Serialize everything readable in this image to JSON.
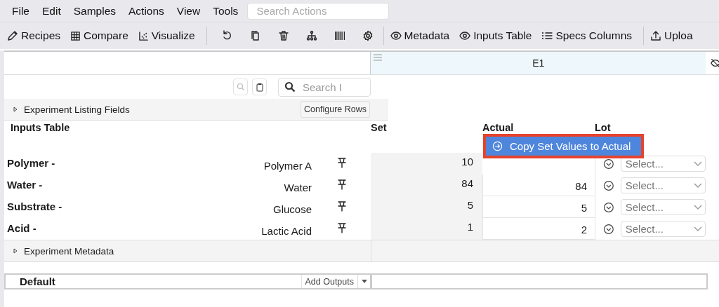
{
  "menu": [
    "File",
    "Edit",
    "Samples",
    "Actions",
    "View",
    "Tools"
  ],
  "search_actions": {
    "placeholder": "Search Actions"
  },
  "toolbar": {
    "view_buttons": [
      "Recipes",
      "Compare",
      "Visualize"
    ],
    "panel_buttons": [
      "Metadata",
      "Inputs Table",
      "Specs Columns"
    ],
    "upload_button": "Uploa"
  },
  "column_header": {
    "label": "E1"
  },
  "table_search": {
    "placeholder": "Search I"
  },
  "listing_section": {
    "title": "Experiment Listing Fields",
    "expanded": false,
    "button": "Configure Rows"
  },
  "inputs_table": {
    "title": "Inputs Table",
    "columns": [
      "Set",
      "Actual",
      "Lot"
    ],
    "rows": [
      {
        "name": "Polymer -",
        "material": "Polymer A",
        "set": "10",
        "lot_placeholder": "Select..."
      },
      {
        "name": "Water -",
        "material": "Water",
        "set": "84",
        "actual": "84",
        "lot_placeholder": "Select..."
      },
      {
        "name": "Substrate -",
        "material": "Glucose",
        "set": "5",
        "actual": "5",
        "lot_placeholder": "Select..."
      },
      {
        "name": "Acid -",
        "material": "Lactic Acid",
        "set": "1",
        "actual": "2",
        "lot_placeholder": "Select..."
      }
    ]
  },
  "popup": {
    "label": "Copy Set Values to Actual"
  },
  "metadata_section": {
    "title": "Experiment Metadata",
    "expanded": false
  },
  "outputs": {
    "group": "Default",
    "button": "Add Outputs"
  }
}
